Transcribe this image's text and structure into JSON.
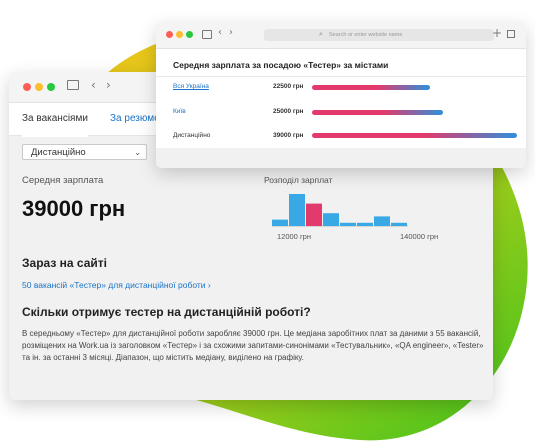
{
  "colors": {
    "blob_green": "#5ecb1c",
    "blob_yellow": "#f4c21a",
    "pink": "#e23a6c",
    "blue": "#2e8fdb",
    "link": "#1a73c8"
  },
  "back_window": {
    "tabs": [
      {
        "label": "За вакансіями"
      },
      {
        "label": "За резюме"
      }
    ],
    "filter_select": {
      "value": "Дистанційно"
    },
    "avg_salary_label": "Середня зарплата",
    "avg_salary_value": "39000 грн",
    "distribution_label": "Розподіл зарплат",
    "histogram": {
      "type": "bar",
      "values": [
        2,
        10,
        7,
        4,
        1,
        1,
        3,
        1
      ],
      "highlighted_index": 2,
      "tick_labels": [
        "12000 грн",
        "140000 грн"
      ]
    },
    "now_on_site_heading": "Зараз на сайті",
    "vacancies_link": "50 вакансій «Тестер» для дистанційної роботи ›",
    "question_heading": "Скільки отримує тестер на дистанційній роботі?",
    "description": "В середньому «Тестер» для дистанційної роботи заробляє 39000 грн. Це медіана заробітних плат за даними з 55 вакансій, розміщених на Work.ua із заголовком «Тестер» і за схожими запитами-синонімами «Тестувальник», «QA engineer», «Tester» та ін. за останні 3 місяці. Діапазон, що містить медіану, виділено на графіку."
  },
  "front_window": {
    "address_placeholder": "Search or enter website name",
    "heading": "Середня зарплата за посадою «Тестер» за містами",
    "chart_data": {
      "type": "bar",
      "categories": [
        "Вся Україна",
        "Київ",
        "Дистанційно"
      ],
      "values": [
        22500,
        25000,
        39000
      ],
      "unit": "грн"
    },
    "rows": [
      {
        "city": "Вся Україна",
        "salary": "22500 грн"
      },
      {
        "city": "Київ",
        "salary": "25000 грн"
      },
      {
        "city": "Дистанційно",
        "salary": "39000 грн"
      }
    ]
  }
}
